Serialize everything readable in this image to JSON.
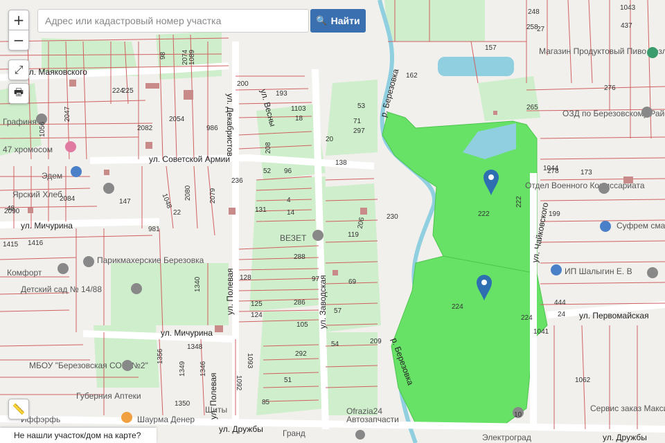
{
  "search": {
    "placeholder": "Адрес или кадастровый номер участка",
    "button_label": "Найти",
    "button_icon": "search-icon"
  },
  "controls": {
    "zoom_in": "+",
    "zoom_out": "−",
    "fullscreen_icon": "fullscreen-icon",
    "print_icon": "print-icon",
    "ruler_icon": "ruler-icon"
  },
  "footer_prompt": "Не нашли участок/дом на карте?",
  "colors": {
    "parcel_line": "#d06060",
    "selected_fill": "#67e267",
    "green_area": "#c9ecc4",
    "river": "#8fcfe0",
    "pin": "#2d6fb0",
    "button": "#3a6fb0"
  },
  "streets": [
    "ул. Маяковского",
    "ул. Советской Армии",
    "ул. Мичурина",
    "ул. Мичурина",
    "ул. Полевая",
    "ул. Полевая",
    "ул. Заводская",
    "ул. Декабристов",
    "ул. Весны",
    "ул. Чайковского",
    "ул. Первомайская",
    "ул. Дружбы",
    "ул. Дружбы",
    "р. Березовка",
    "р. Березовка"
  ],
  "pois": [
    "Парикмахерские Березовка",
    "Детский сад № 14/88",
    "МБОУ \"Березовская СОШ №2\"",
    "ВЕЗЕТ",
    "Эдем",
    "Ярский Хлеб",
    "Комфорт",
    "47 хромосом",
    "Губерния Аптеки",
    "Шаурма Денер",
    "Магазин Продуктовый Пиво Розливное Алина",
    "ОЗД по Березовскому Району",
    "Отдел Военного Комиссариата",
    "Суфрем смазочные",
    "ИП Шалыгин Е. В",
    "Сервис заказ Максим» в",
    "Электроград",
    "Гранд",
    "Автозапчасти",
    "Иффэрфь",
    "Ofrazia24",
    "Графиня",
    "Щиты"
  ],
  "parcel_numbers": [
    "248",
    "1043",
    "258",
    "437",
    "27",
    "157",
    "162",
    "265",
    "276",
    "1044",
    "173",
    "278",
    "199",
    "444",
    "24",
    "1041",
    "1062",
    "222",
    "222",
    "224",
    "224",
    "230",
    "209",
    "10",
    "200",
    "193",
    "1103",
    "53",
    "71",
    "297",
    "18",
    "208",
    "20",
    "138",
    "96",
    "52",
    "236",
    "4",
    "14",
    "131",
    "206",
    "119",
    "288",
    "128",
    "97",
    "125",
    "286",
    "69",
    "124",
    "57",
    "105",
    "54",
    "292",
    "1093",
    "51",
    "1092",
    "85",
    "2054",
    "986",
    "2082",
    "1048",
    "2080",
    "2079",
    "1340",
    "1356",
    "1349",
    "1346",
    "1350",
    "1348",
    "147",
    "1416",
    "1415",
    "2090",
    "2084",
    "2047",
    "1056",
    "981",
    "98",
    "22",
    "48",
    "2074",
    "1089",
    "224",
    "225"
  ],
  "markers": [
    "parcel-pin",
    "parcel-pin"
  ]
}
